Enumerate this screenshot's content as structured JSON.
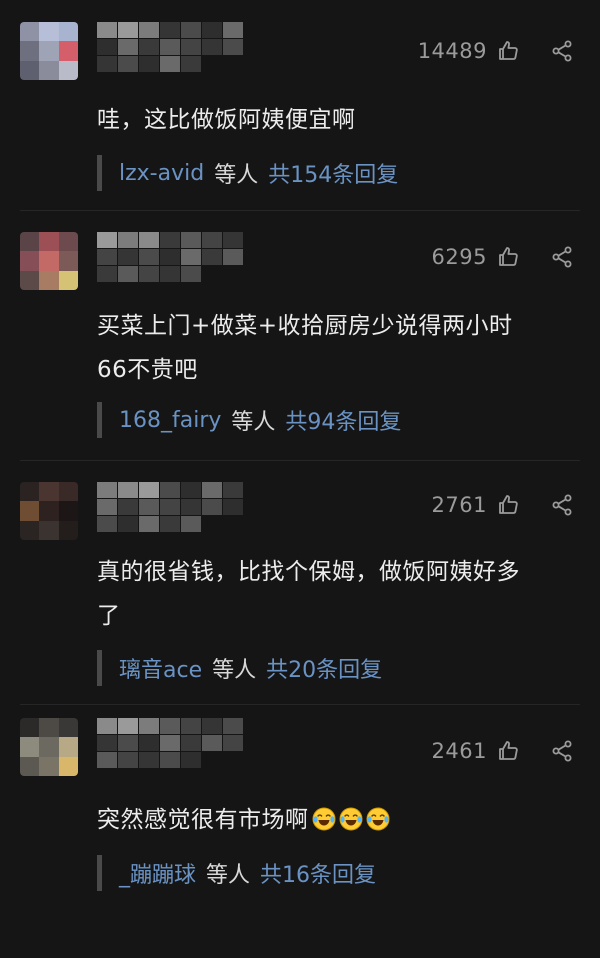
{
  "comments": [
    {
      "likes": "14489",
      "text_lines": [
        "哇，这比做饭阿姨便宜啊"
      ],
      "reply_user": "lzx-avid",
      "reply_mid": "等人",
      "reply_count": "共154条回复",
      "avatar_colors": [
        "#8f92a5",
        "#b7bfd8",
        "#a8b3cf",
        "#6e6f7f",
        "#9ea3b6",
        "#d45f6b",
        "#5e6070",
        "#8a8c9b",
        "#b9bcc8"
      ]
    },
    {
      "likes": "6295",
      "text_lines": [
        "买菜上门+做菜+收拾厨房少说得两小时",
        "66不贵吧"
      ],
      "reply_user": "168_fairy",
      "reply_mid": "等人",
      "reply_count": "共94条回复",
      "avatar_colors": [
        "#5a4448",
        "#9c5055",
        "#6d4a4d",
        "#864e57",
        "#c46a66",
        "#7b5a58",
        "#5b4a47",
        "#a87c62",
        "#d6c274"
      ]
    },
    {
      "likes": "2761",
      "text_lines": [
        "真的很省钱，比找个保姆，做饭阿姨好多",
        "了"
      ],
      "reply_user": "璃音ace",
      "reply_mid": "等人",
      "reply_count": "共20条回复",
      "avatar_colors": [
        "#2b2322",
        "#4a3530",
        "#3a2a27",
        "#6e4d32",
        "#2d221f",
        "#1c1716",
        "#2a2422",
        "#3a3330",
        "#231d1c"
      ]
    },
    {
      "likes": "2461",
      "text_lines": [
        "突然感觉很有市场啊"
      ],
      "emoji_count": 3,
      "reply_user": "_蹦蹦球",
      "reply_mid": "等人",
      "reply_count": "共16条回复",
      "avatar_colors": [
        "#2c2a28",
        "#4d4944",
        "#3a3836",
        "#8d8a7e",
        "#6c6a60",
        "#b7a986",
        "#5b5952",
        "#7a7466",
        "#d8b76b"
      ]
    }
  ],
  "icons": {
    "like": "thumbs-up-icon",
    "share": "share-icon",
    "emoji": "laughing-crying-face-icon"
  },
  "colors": {
    "background": "#151515",
    "text": "#ececec",
    "link": "#6a93c4",
    "muted": "#9b9b9b"
  }
}
